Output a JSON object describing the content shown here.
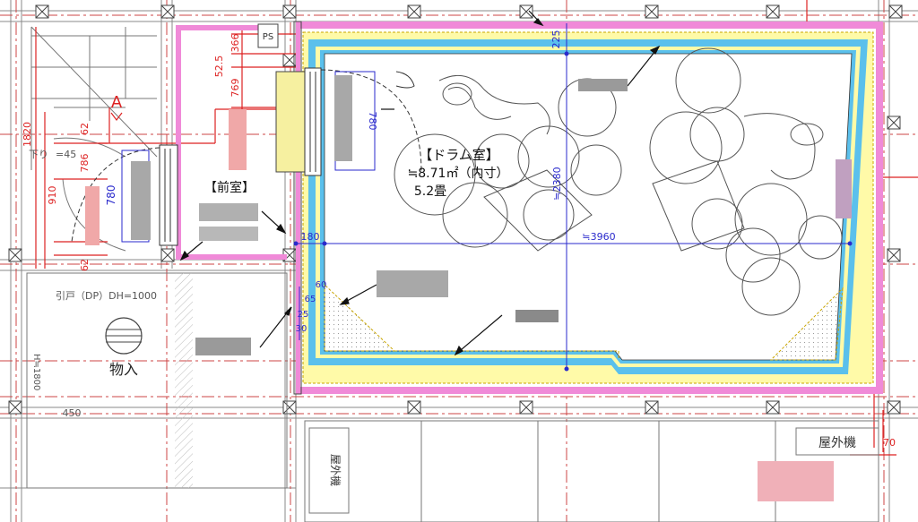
{
  "rooms": {
    "drum": {
      "name": "【ドラム室】",
      "area": "≒8.71㎡（内寸）",
      "tatami": "5.2畳"
    },
    "anteroom": {
      "name": "【前室】"
    },
    "storage": {
      "name": "物入"
    },
    "ps": "PS"
  },
  "labels": {
    "point_a": "A",
    "sliding_door": "引戸（DP）DH=1000",
    "stair_down": "下り",
    "stair_eq": "=45",
    "h_note": "H≒1800",
    "outdoor_unit": "屋外機"
  },
  "dims_blue": {
    "top_clear": "225",
    "height_inner": "≒2380",
    "width_inner": "≒3960",
    "wall_left": "180",
    "door_width": "780",
    "door_width_right": "780",
    "layer_60": "60",
    "layer_65": "65",
    "layer_25": "25",
    "layer_30": "30"
  },
  "dims_red": {
    "d366": "366",
    "d52_5": "52.5",
    "d769": "769",
    "d1820": "1820",
    "d62_top": "62",
    "d786": "786",
    "d910": "910",
    "d62_bottom": "62",
    "d70": "70",
    "d450": "450"
  },
  "colors": {
    "insulation_pink": "#f08ad8",
    "acoustic_blue": "#5bc0ec",
    "acoustic_yellow": "#fffaa8",
    "dimension_blue": "#2a2acc",
    "dimension_red": "#dd2222",
    "grid_red": "#cc4444",
    "door_yellow": "#f6f0a0"
  }
}
